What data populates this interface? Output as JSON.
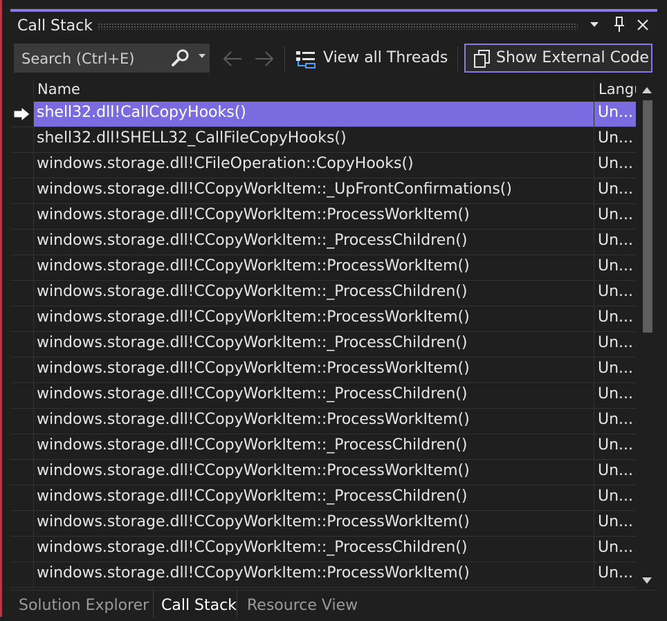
{
  "window": {
    "title": "Call Stack",
    "dropdown_icon": "chevron-down-icon",
    "pin_icon": "pin-icon",
    "close_icon": "close-icon"
  },
  "toolbar": {
    "search": {
      "placeholder": "Search (Ctrl+E)",
      "value": ""
    },
    "view_threads_label": "View all Threads",
    "show_external_label": "Show External Code"
  },
  "grid": {
    "columns": [
      "Name",
      "Langu"
    ],
    "rows": [
      {
        "name": "shell32.dll!CallCopyHooks()",
        "lang": "Un...",
        "current": true
      },
      {
        "name": "shell32.dll!SHELL32_CallFileCopyHooks()",
        "lang": "Un..."
      },
      {
        "name": "windows.storage.dll!CFileOperation::CopyHooks()",
        "lang": "Un..."
      },
      {
        "name": "windows.storage.dll!CCopyWorkItem::_UpFrontConfirmations()",
        "lang": "Un..."
      },
      {
        "name": "windows.storage.dll!CCopyWorkItem::ProcessWorkItem()",
        "lang": "Un..."
      },
      {
        "name": "windows.storage.dll!CCopyWorkItem::_ProcessChildren()",
        "lang": "Un..."
      },
      {
        "name": "windows.storage.dll!CCopyWorkItem::ProcessWorkItem()",
        "lang": "Un..."
      },
      {
        "name": "windows.storage.dll!CCopyWorkItem::_ProcessChildren()",
        "lang": "Un..."
      },
      {
        "name": "windows.storage.dll!CCopyWorkItem::ProcessWorkItem()",
        "lang": "Un..."
      },
      {
        "name": "windows.storage.dll!CCopyWorkItem::_ProcessChildren()",
        "lang": "Un..."
      },
      {
        "name": "windows.storage.dll!CCopyWorkItem::ProcessWorkItem()",
        "lang": "Un..."
      },
      {
        "name": "windows.storage.dll!CCopyWorkItem::_ProcessChildren()",
        "lang": "Un..."
      },
      {
        "name": "windows.storage.dll!CCopyWorkItem::ProcessWorkItem()",
        "lang": "Un..."
      },
      {
        "name": "windows.storage.dll!CCopyWorkItem::_ProcessChildren()",
        "lang": "Un..."
      },
      {
        "name": "windows.storage.dll!CCopyWorkItem::ProcessWorkItem()",
        "lang": "Un..."
      },
      {
        "name": "windows.storage.dll!CCopyWorkItem::_ProcessChildren()",
        "lang": "Un..."
      },
      {
        "name": "windows.storage.dll!CCopyWorkItem::ProcessWorkItem()",
        "lang": "Un..."
      },
      {
        "name": "windows.storage.dll!CCopyWorkItem::_ProcessChildren()",
        "lang": "Un..."
      },
      {
        "name": "windows.storage.dll!CCopyWorkItem::ProcessWorkItem()",
        "lang": "Un..."
      }
    ]
  },
  "bottom_tabs": [
    "Solution Explorer",
    "Call Stack",
    "Resource View"
  ],
  "active_tab": "Call Stack",
  "colors": {
    "accent": "#8a76e6",
    "selection": "#7b6be0",
    "background": "#1f1f1f"
  }
}
